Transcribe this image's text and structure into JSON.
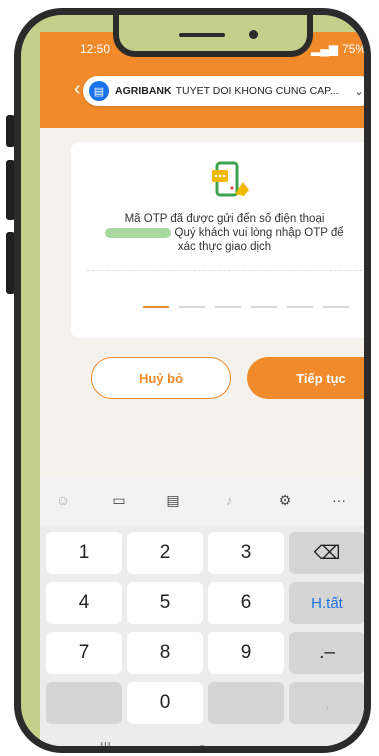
{
  "status": {
    "time": "12:50",
    "battery": "75%"
  },
  "header": {
    "site_bold": "AGRIBANK",
    "site_rest": "TUYET DOI KHONG CUNG CAP..."
  },
  "otp": {
    "message_line1": "Mã OTP đã được gửi đến số điện thoại",
    "message_line2": "Quý khách vui lòng nhập OTP để",
    "message_line3": "xác thực giao dịch",
    "digit_count": 6
  },
  "buttons": {
    "cancel": "Huỷ bỏ",
    "continue": "Tiếp tục"
  },
  "keyboard": {
    "keys": [
      "1",
      "2",
      "3",
      "4",
      "5",
      "6",
      "7",
      "8",
      "9",
      "0"
    ],
    "done_label": "H.tất",
    "special_dot_dash": ".–",
    "comma": ","
  },
  "colors": {
    "accent": "#f08a2a",
    "link_blue": "#1a73e8"
  }
}
